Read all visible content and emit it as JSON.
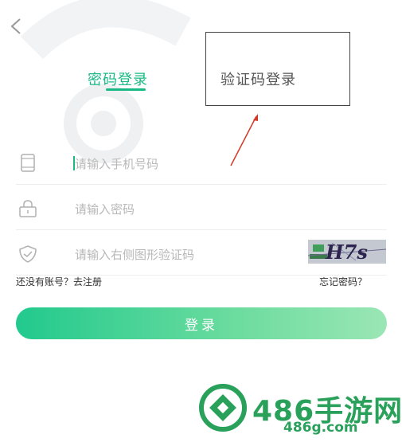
{
  "tabs": {
    "password_login": "密码登录",
    "code_login": "验证码登录"
  },
  "fields": {
    "phone_placeholder": "请输入手机号码",
    "password_placeholder": "请输入密码",
    "captcha_placeholder": "请输入右侧图形验证码",
    "captcha_image_text": "H7s"
  },
  "links": {
    "register": "还没有账号？去注册",
    "forgot": "忘记密码？"
  },
  "login_button": "登录",
  "watermark": {
    "title": "486手游网",
    "url": "486g.com"
  },
  "colors": {
    "accent": "#19b985",
    "button_start": "#22c98d",
    "button_end": "#9ae6b5",
    "watermark": "#2aa15a"
  }
}
